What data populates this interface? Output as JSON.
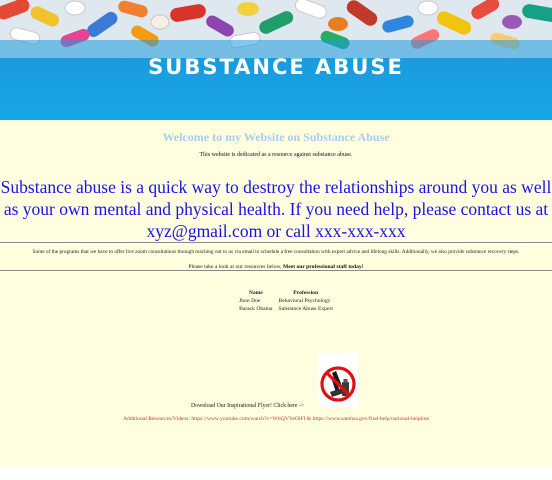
{
  "banner": {
    "title": "SUBSTANCE ABUSE"
  },
  "welcome": "Welcome to my Website on Substance Abuse",
  "dedicated": "This website is dedicated as a resource against substance abuse.",
  "intro": "Substance abuse is a quick way to destroy the relationships around you as well as your own mental and physical health. If you need help, please contact us at xyz@gmail.com or call xxx-xxx-xxx",
  "programs": "Some of the programs that we have to offer live zoom consultations through reaching out to us via email to schedule a free consultation with expert advice and lifelong skills. Additionally, we also provide substance recovery steps.",
  "resources": {
    "prefix": "Please take a look at our resources below, ",
    "bold": "Meet our professional staff today!"
  },
  "staff": {
    "headers": [
      "Name",
      "Profession"
    ],
    "rows": [
      [
        "Jhon Doe",
        "Behavioral Psychology"
      ],
      [
        "Barack Obama",
        "Substance Abuse Expert"
      ]
    ]
  },
  "flyer": {
    "text": "Download Our Inspirational Flyer! Click here ->",
    "icon": "no-drugs-icon"
  },
  "additional": "Additional Resources/Videos: https://www.youtube.com/watch?v=WtiQVYeOiFI & https://www.samhsa.gov/find-help/national-helpline"
}
